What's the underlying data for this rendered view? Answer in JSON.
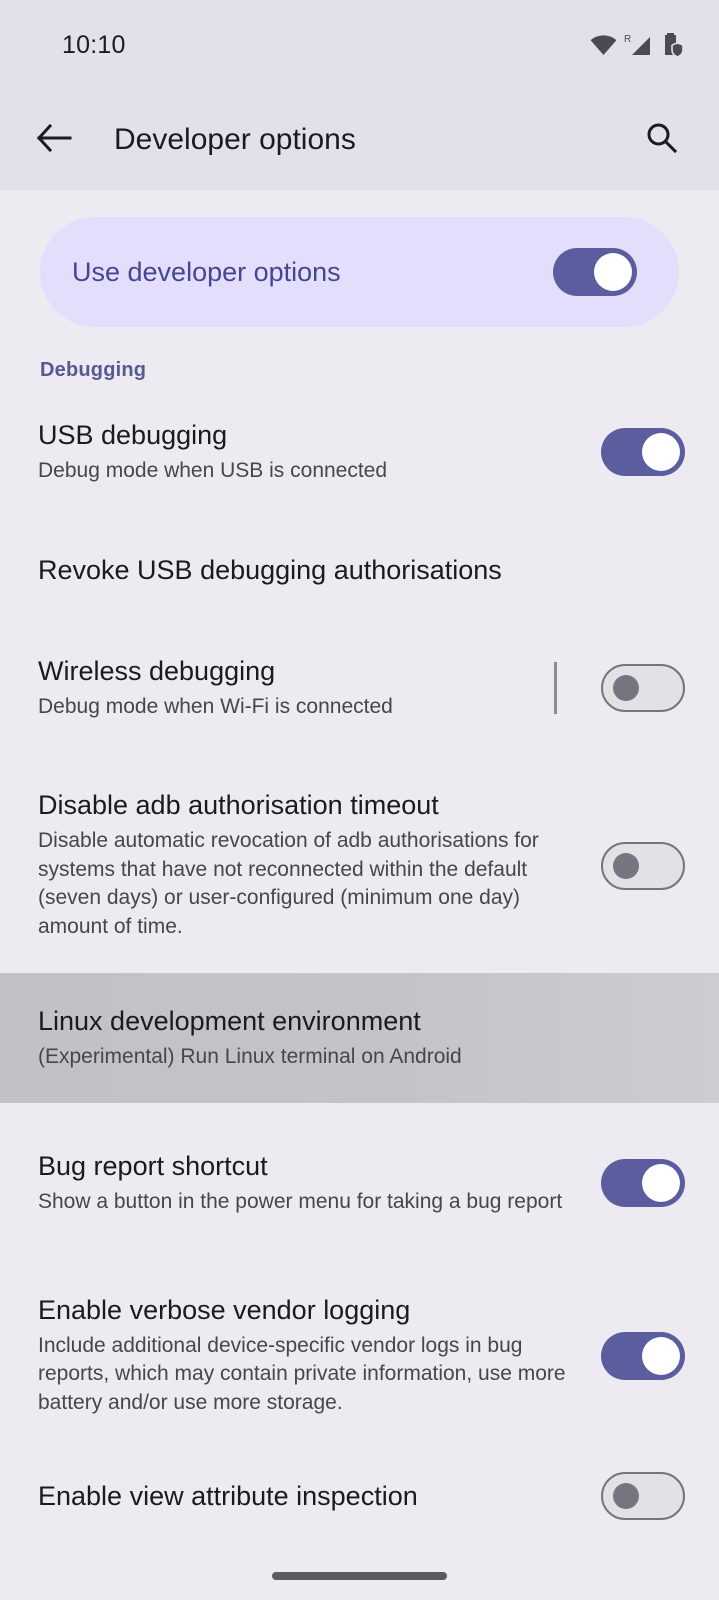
{
  "status_bar": {
    "time": "10:10",
    "icons": [
      "wifi-icon",
      "roaming-signal-icon",
      "battery-protected-icon"
    ],
    "roaming_label": "R"
  },
  "app_bar": {
    "back_icon": "back-arrow-icon",
    "title": "Developer options",
    "search_icon": "search-icon"
  },
  "master_switch": {
    "label": "Use developer options",
    "state": "on"
  },
  "sections": [
    {
      "header": "Debugging",
      "rows": [
        {
          "title": "USB debugging",
          "subtitle": "Debug mode when USB is connected",
          "control": "switch",
          "state": "on",
          "divider": false,
          "highlighted": false
        },
        {
          "title": "Revoke USB debugging authorisations",
          "subtitle": "",
          "control": "none",
          "state": "",
          "divider": false,
          "highlighted": false
        },
        {
          "title": "Wireless debugging",
          "subtitle": "Debug mode when Wi-Fi is connected",
          "control": "switch",
          "state": "off",
          "divider": true,
          "highlighted": false
        },
        {
          "title": "Disable adb authorisation timeout",
          "subtitle": "Disable automatic revocation of adb authorisations for systems that have not reconnected within the default (seven days) or user-configured (minimum one day) amount of time.",
          "control": "switch",
          "state": "off",
          "divider": false,
          "highlighted": false
        },
        {
          "title": "Linux development environment",
          "subtitle": "(Experimental) Run Linux terminal on Android",
          "control": "none",
          "state": "",
          "divider": false,
          "highlighted": true
        },
        {
          "title": "Bug report shortcut",
          "subtitle": "Show a button in the power menu for taking a bug report",
          "control": "switch",
          "state": "on",
          "divider": false,
          "highlighted": false
        },
        {
          "title": "Enable verbose vendor logging",
          "subtitle": "Include additional device-specific vendor logs in bug reports, which may contain private information, use more battery and/or use more storage.",
          "control": "switch",
          "state": "on",
          "divider": false,
          "highlighted": false
        },
        {
          "title": "Enable view attribute inspection",
          "subtitle": "",
          "control": "switch",
          "state": "off",
          "divider": false,
          "highlighted": false
        }
      ]
    }
  ],
  "nav_bar": {
    "handle": "gesture-home-handle"
  },
  "colors": {
    "accent_purple": "#5B5D9E",
    "section_header": "#565992",
    "master_card_bg": "#E3DEFB",
    "master_label": "#474693",
    "page_bg": "#EDEAF1",
    "app_bar_bg": "#E2E0E9",
    "highlight_bg": "#C5C2C9",
    "switch_off_bg": "#E4E1E6",
    "switch_off_border": "#75757E"
  }
}
